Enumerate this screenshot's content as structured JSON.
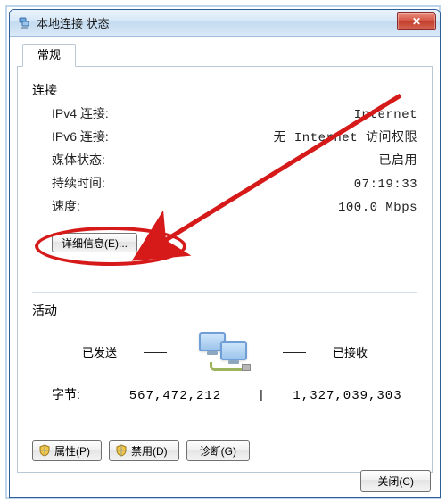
{
  "window": {
    "title": "本地连接 状态",
    "close_glyph": "✕"
  },
  "tab": {
    "label": "常规"
  },
  "connection": {
    "group_title": "连接",
    "rows": [
      {
        "label": "IPv4 连接:",
        "value": "Internet"
      },
      {
        "label": "IPv6 连接:",
        "value": "无 Internet 访问权限"
      },
      {
        "label": "媒体状态:",
        "value": "已启用"
      },
      {
        "label": "持续时间:",
        "value": "07:19:33"
      },
      {
        "label": "速度:",
        "value": "100.0 Mbps"
      }
    ],
    "details_button": "详细信息(E)..."
  },
  "activity": {
    "group_title": "活动",
    "sent_label": "已发送",
    "received_label": "已接收",
    "bytes_label": "字节:",
    "bytes_sent": "567,472,212",
    "bytes_received": "1,327,039,303"
  },
  "buttons": {
    "properties": "属性(P)",
    "disable": "禁用(D)",
    "diagnose": "诊断(G)",
    "close": "关闭(C)"
  },
  "annotation": {
    "type": "arrow+circle",
    "target": "details-button",
    "color": "#d61a1a"
  }
}
